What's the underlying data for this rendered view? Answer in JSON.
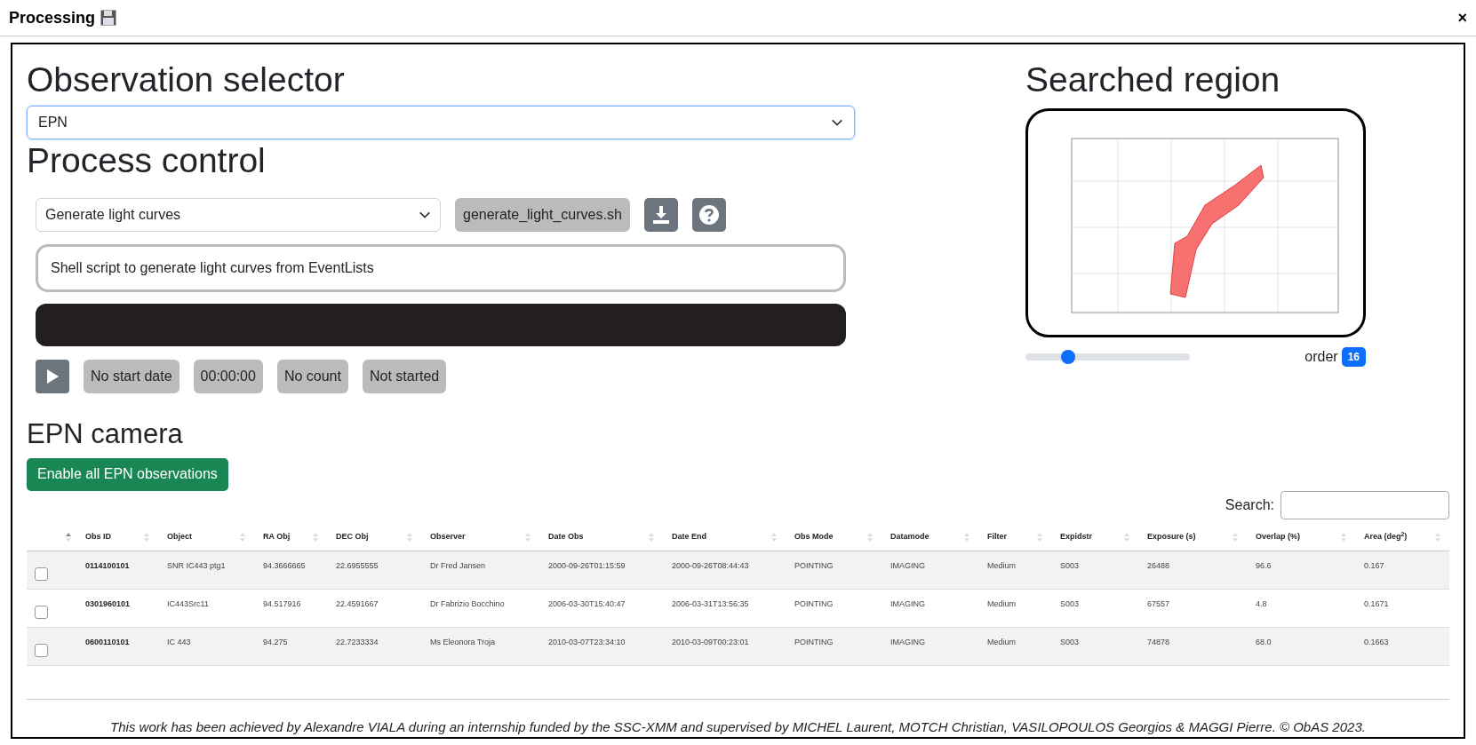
{
  "window": {
    "title": "Processing",
    "close_label": "×"
  },
  "observation_selector": {
    "heading": "Observation selector",
    "value": "EPN"
  },
  "process_control": {
    "heading": "Process control",
    "process": "Generate light curves",
    "script": "generate_light_curves.sh",
    "description": "Shell script to generate light curves from EventLists",
    "status": {
      "start_date": "No start date",
      "elapsed": "00:00:00",
      "count": "No count",
      "state": "Not started"
    }
  },
  "searched_region": {
    "heading": "Searched region",
    "slider": {
      "level": 0.26
    },
    "order_label": "order",
    "order_value": "16"
  },
  "camera": {
    "heading": "EPN camera",
    "enable_button": "Enable all EPN observations",
    "search_label": "Search:",
    "table": {
      "columns": [
        "Obs ID",
        "Object",
        "RA Obj",
        "DEC Obj",
        "Observer",
        "Date Obs",
        "Date End",
        "Obs Mode",
        "Datamode",
        "Filter",
        "Expidstr",
        "Exposure (s)",
        "Overlap (%)",
        "Area (deg$^{2}$)"
      ],
      "rows": [
        {
          "checked": false,
          "cells": [
            "0114100101",
            "SNR IC443 ptg1",
            "94.3666665",
            "22.6955555",
            "Dr Fred Jansen",
            "2000-09-26T01:15:59",
            "2000-09-26T08:44:43",
            "POINTING",
            "IMAGING",
            "Medium",
            "S003",
            "26488",
            "96.6",
            "0.167"
          ]
        },
        {
          "checked": false,
          "cells": [
            "0301960101",
            "IC443Src11",
            "94.517916",
            "22.4591667",
            "Dr Fabrizio Bocchino",
            "2006-03-30T15:40:47",
            "2006-03-31T13:56:35",
            "POINTING",
            "IMAGING",
            "Medium",
            "S003",
            "67557",
            "4.8",
            "0.1671"
          ]
        },
        {
          "checked": false,
          "cells": [
            "0600110101",
            "IC 443",
            "94.275",
            "22.7233334",
            "Ms Eleonora Troja",
            "2010-03-07T23:34:10",
            "2010-03-09T00:23:01",
            "POINTING",
            "IMAGING",
            "Medium",
            "S003",
            "74878",
            "68.0",
            "0.1663"
          ]
        }
      ]
    }
  },
  "footer": "This work has been achieved by Alexandre VIALA during an internship funded by the SSC-XMM and supervised by MICHEL Laurent, MOTCH Christian, VASILOPOULOS Georgios & MAGGI Pierre. © ObAS 2023."
}
